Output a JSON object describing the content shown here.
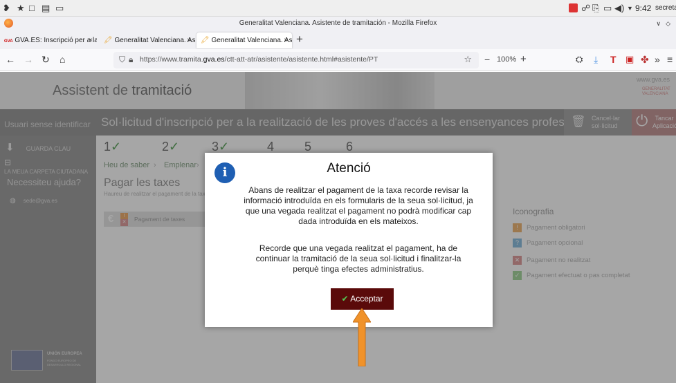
{
  "system": {
    "time": "9:42",
    "user": "secretari"
  },
  "window": {
    "title": "Generalitat Valenciana. Asistente de tramitación - Mozilla Firefox"
  },
  "tabs": [
    {
      "label": "GVA.ES: Inscripció per a la"
    },
    {
      "label": "Generalitat Valenciana. As"
    },
    {
      "label": "Generalitat Valenciana. As"
    }
  ],
  "nav": {
    "url_prefix": "https://www.tramita.",
    "url_domain": "gva.es",
    "url_path": "/ctt-att-atr/asistente/asistente.html#asistente/PT",
    "zoom": "100%"
  },
  "header": {
    "app_name_light": "Assistent de ",
    "app_name_bold": "tramitació",
    "gva_link": "www.gva.es",
    "gva_logo": "GENERALITAT VALENCIANA"
  },
  "titlebar": {
    "user": "Usuari sense identificar",
    "form_title": "Sol·licitud d'inscripció per a la realització de les proves d'accés a les ensenyances professionals de música i dansa",
    "cancel_label": "Cancel·lar sol·licitud",
    "close_label": "Tancar Aplicació"
  },
  "sidebar": {
    "save_key": "GUARDA CLAU",
    "citizen_folder": "LA MEUA CARPETA CIUTADANA",
    "help_title": "Necessiteu ajuda?",
    "email": "sede@gva.es",
    "eu_title": "UNIÓN EUROPEA",
    "eu_fund_1": "FONDO EUROPEO DE",
    "eu_fund_2": "DESARROLLO REGIONAL"
  },
  "steps": [
    {
      "num": "1",
      "label": "Heu de saber"
    },
    {
      "num": "2",
      "label": "Emplenar"
    },
    {
      "num": "3",
      "label": ""
    },
    {
      "num": "4",
      "label": ""
    },
    {
      "num": "5",
      "label": ""
    },
    {
      "num": "6",
      "label": ""
    }
  ],
  "main": {
    "title": "Pagar les taxes",
    "subtitle": "Haureu de realitzar el pagament de la taxa c",
    "pay_item": "Pagament de taxes"
  },
  "legend": {
    "title": "Iconografia",
    "items": [
      {
        "label": "Pagament obligatori",
        "color": "#f0b878",
        "glyph": "!"
      },
      {
        "label": "Pagament opcional",
        "color": "#8fc0e0",
        "glyph": "?"
      },
      {
        "label": "Pagament no realitzat",
        "color": "#e0a0a0",
        "glyph": "✕"
      },
      {
        "label": "Pagament efectuat o pas completat",
        "color": "#a8d8a0",
        "glyph": "✓"
      }
    ]
  },
  "modal": {
    "title": "Atenció",
    "paragraph1": "Abans de realitzar el pagament de la taxa recorde revisar la informació introduïda en els formularis de la seua sol·licitud, ja que una vegada realitzat el pagament no podrà modificar cap dada introduïda en els mateixos.",
    "paragraph2": "Recorde que una vegada realitzat el pagament, ha de continuar la tramitació de la seua sol·licitud i finalitzar-la perquè tinga efectes administratius.",
    "accept_label": "Acceptar"
  },
  "colors": {
    "accept_bg": "#5a0a0a",
    "info_icon": "#1f5fb3",
    "arrow": "#f0922a"
  }
}
